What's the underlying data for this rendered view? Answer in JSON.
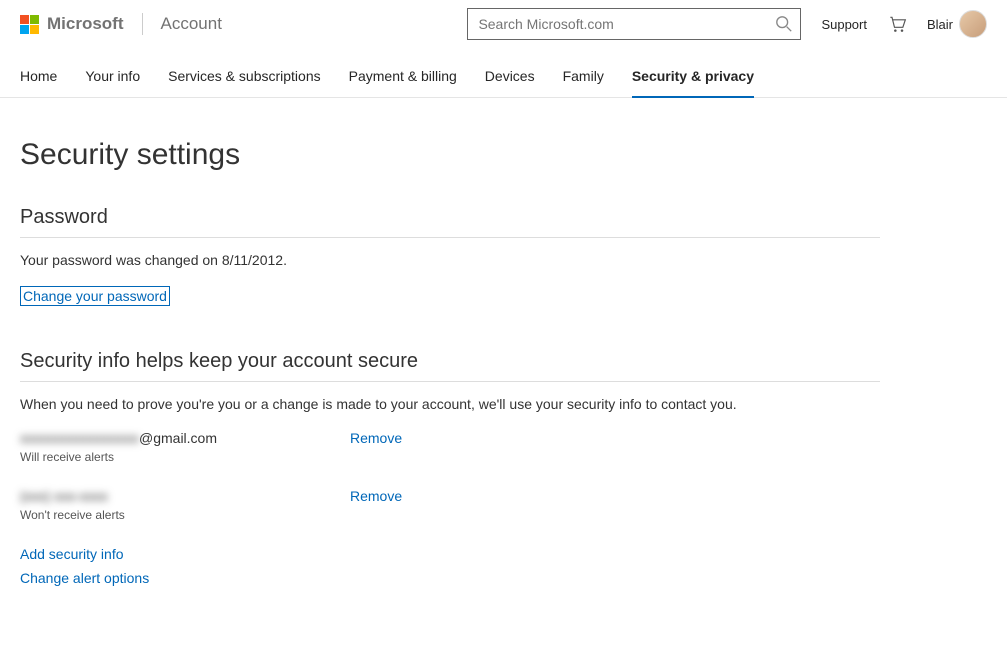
{
  "header": {
    "brand": "Microsoft",
    "section": "Account",
    "search_placeholder": "Search Microsoft.com",
    "support_label": "Support",
    "user_name": "Blair"
  },
  "nav": {
    "items": [
      {
        "label": "Home"
      },
      {
        "label": "Your info"
      },
      {
        "label": "Services & subscriptions"
      },
      {
        "label": "Payment & billing"
      },
      {
        "label": "Devices"
      },
      {
        "label": "Family"
      },
      {
        "label": "Security & privacy"
      }
    ],
    "active_index": 6
  },
  "page": {
    "title": "Security settings",
    "password": {
      "heading": "Password",
      "status": "Your password was changed on 8/11/2012.",
      "change_link": "Change your password"
    },
    "security_info": {
      "heading": "Security info helps keep your account secure",
      "description": "When you need to prove you're you or a change is made to your account, we'll use your security info to contact you.",
      "items": [
        {
          "value_prefix": "xxxxxxxxxxxxxxxxx",
          "value_suffix": "@gmail.com",
          "sub": "Will receive alerts",
          "action": "Remove"
        },
        {
          "value_prefix": "(xxx) xxx-xxxx",
          "value_suffix": "",
          "sub": "Won't receive alerts",
          "action": "Remove"
        }
      ],
      "add_link": "Add security info",
      "change_alerts_link": "Change alert options"
    }
  }
}
